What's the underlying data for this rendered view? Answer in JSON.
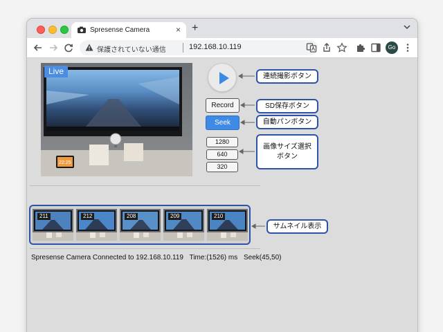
{
  "browser": {
    "tab_title": "Spresense Camera",
    "tab_close": "×",
    "new_tab": "+",
    "security_text": "保護されていない通信",
    "url": "192.168.10.119",
    "avatar": "Go"
  },
  "main": {
    "live_badge": "Live",
    "live_clock": "22:25"
  },
  "controls": {
    "record_label": "Record",
    "seek_label": "Seek",
    "sizes": [
      "1280",
      "640",
      "320"
    ]
  },
  "thumbnails": [
    {
      "label": "211"
    },
    {
      "label": "212"
    },
    {
      "label": "208"
    },
    {
      "label": "209"
    },
    {
      "label": "210"
    }
  ],
  "status": {
    "connection": "Spresense Camera Connected to 192.168.10.119",
    "time": "Time:(1526) ms",
    "seek": "Seek(45,50)"
  },
  "annotations": {
    "continuous": "連続撮影ボタン",
    "sd_save": "SD保存ボタン",
    "auto_pan": "自動パンボタン",
    "image_size_line1": "画像サイズ選択",
    "image_size_line2": "ボタン",
    "thumbnail_display": "サムネイル表示"
  },
  "colors": {
    "accent": "#3f8ae5",
    "callout_border": "#2c53a8",
    "live_badge": "#4b8de0"
  }
}
